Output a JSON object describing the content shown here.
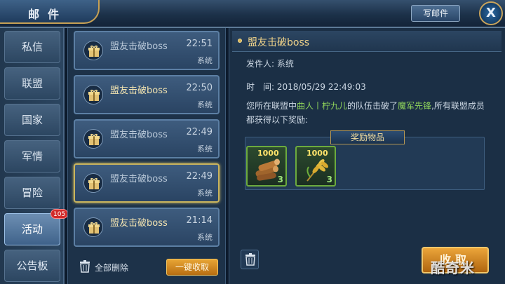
{
  "header": {
    "title": "邮件",
    "write_mail": "写邮件",
    "close": "X"
  },
  "nav": {
    "items": [
      {
        "label": "私信"
      },
      {
        "label": "联盟"
      },
      {
        "label": "国家"
      },
      {
        "label": "军情"
      },
      {
        "label": "冒险"
      },
      {
        "label": "活动",
        "active": true
      },
      {
        "label": "公告板"
      }
    ],
    "activity_badge": "105"
  },
  "mail_list": [
    {
      "subject": "盟友击破boss",
      "time": "22:51",
      "sender": "系统",
      "read": true
    },
    {
      "subject": "盟友击破boss",
      "time": "22:50",
      "sender": "系统",
      "read": false
    },
    {
      "subject": "盟友击破boss",
      "time": "22:49",
      "sender": "系统",
      "read": true
    },
    {
      "subject": "盟友击破boss",
      "time": "22:49",
      "sender": "系统",
      "read": true,
      "selected": true
    },
    {
      "subject": "盟友击破boss",
      "time": "21:14",
      "sender": "系统",
      "read": false
    }
  ],
  "list_footer": {
    "delete_all": "全部删除",
    "collect_all": "一键收取"
  },
  "detail": {
    "title": "盟友击破boss",
    "sender_line": "发件人: 系统",
    "time_line": "时　间: 2018/05/29  22:49:03",
    "body_pre": "您所在联盟中",
    "body_name": "曲人丨柠九儿",
    "body_mid": "的队伍击破了",
    "body_boss": "魔军先锋",
    "body_post": ",所有联盟成员都获得以下奖励:",
    "rewards_label": "奖励物品",
    "rewards": [
      {
        "icon": "wood-logs-icon",
        "amount": "1000",
        "count": "3"
      },
      {
        "icon": "wheat-icon",
        "amount": "1000",
        "count": "3"
      }
    ],
    "collect": "收取"
  },
  "watermark": "酷奇米",
  "colors": {
    "accent_gold": "#e8a535",
    "highlight_green": "#8fd45b",
    "badge_red": "#d22a2a"
  }
}
